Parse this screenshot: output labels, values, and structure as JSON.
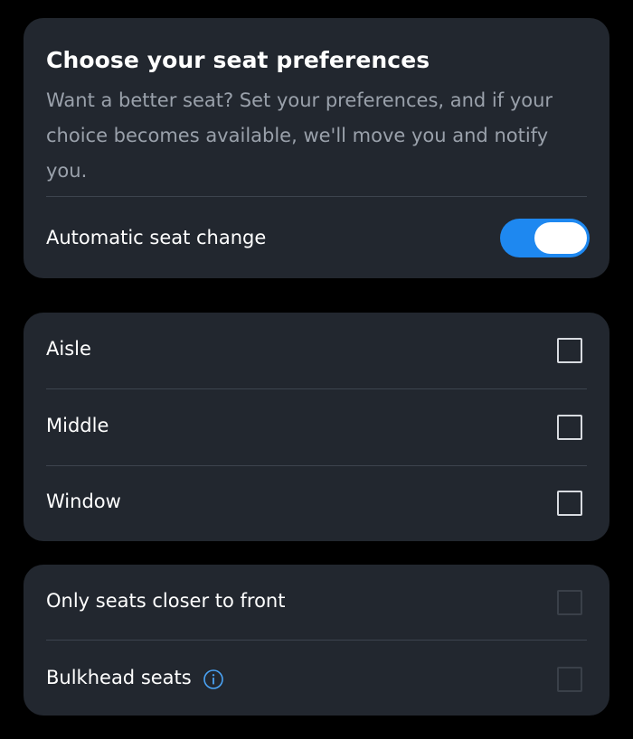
{
  "preferences": {
    "title": "Choose your seat preferences",
    "description": "Want a better seat? Set your preferences, and if your choice becomes available, we'll move you and notify you.",
    "auto_change_label": "Automatic seat change",
    "auto_change_enabled": true
  },
  "seat_types": [
    {
      "label": "Aisle",
      "checked": false
    },
    {
      "label": "Middle",
      "checked": false
    },
    {
      "label": "Window",
      "checked": false
    }
  ],
  "extras": [
    {
      "label": "Only seats closer to front",
      "checked": false,
      "disabled": true
    },
    {
      "label": "Bulkhead seats",
      "checked": false,
      "disabled": true,
      "icon": "info-icon"
    }
  ],
  "colors": {
    "background": "#000000",
    "card": "#22272f",
    "accent": "#1e88f0",
    "muted_text": "#9aa1ab",
    "info_icon": "#4aa3f5"
  }
}
